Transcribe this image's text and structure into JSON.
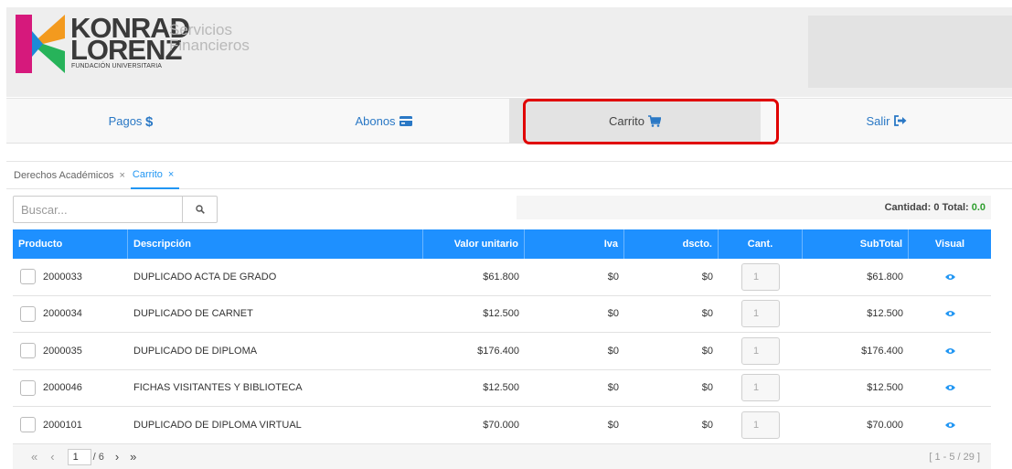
{
  "brand": {
    "line1": "KONRAD",
    "line2": "LORENZ",
    "tagline": "FUNDACIÓN UNIVERSITARIA",
    "service1": "Servicios",
    "service2": "Financieros",
    "colors": {
      "magenta": "#d6197c",
      "orange": "#f39a1e",
      "green": "#27b35a",
      "blue": "#1d8ad8",
      "gray": "#b9b9b9"
    }
  },
  "nav": {
    "items": [
      {
        "label": "Pagos",
        "icon": "dollar-icon"
      },
      {
        "label": "Abonos",
        "icon": "credit-card-icon"
      },
      {
        "label": "Carrito",
        "icon": "cart-icon",
        "active": true
      },
      {
        "label": "Salir",
        "icon": "sign-out-icon"
      }
    ],
    "highlight_color": "#e00000"
  },
  "tabs": [
    {
      "label": "Derechos Académicos",
      "close": "×"
    },
    {
      "label": "Carrito",
      "close": "×",
      "active": true
    }
  ],
  "search": {
    "placeholder": "Buscar...",
    "icon": "search-icon"
  },
  "summary": {
    "quantity_label": "Cantidad:",
    "quantity_value": "0",
    "total_label": "Total:",
    "total_value": "0.0"
  },
  "table": {
    "header_color": "#1e90ff",
    "columns": [
      "Producto",
      "Descripción",
      "Valor unitario",
      "Iva",
      "dscto.",
      "Cant.",
      "SubTotal",
      "Visual"
    ],
    "rows": [
      {
        "producto": "2000033",
        "descripcion": "DUPLICADO ACTA DE GRADO",
        "valor": "$61.800",
        "iva": "$0",
        "dscto": "$0",
        "cant": "1",
        "subtotal": "$61.800"
      },
      {
        "producto": "2000034",
        "descripcion": "DUPLICADO DE CARNET",
        "valor": "$12.500",
        "iva": "$0",
        "dscto": "$0",
        "cant": "1",
        "subtotal": "$12.500"
      },
      {
        "producto": "2000035",
        "descripcion": "DUPLICADO DE DIPLOMA",
        "valor": "$176.400",
        "iva": "$0",
        "dscto": "$0",
        "cant": "1",
        "subtotal": "$176.400"
      },
      {
        "producto": "2000046",
        "descripcion": "FICHAS VISITANTES Y BIBLIOTECA",
        "valor": "$12.500",
        "iva": "$0",
        "dscto": "$0",
        "cant": "1",
        "subtotal": "$12.500"
      },
      {
        "producto": "2000101",
        "descripcion": "DUPLICADO DE DIPLOMA VIRTUAL",
        "valor": "$70.000",
        "iva": "$0",
        "dscto": "$0",
        "cant": "1",
        "subtotal": "$70.000"
      }
    ]
  },
  "pager": {
    "first": "«",
    "prev": "‹",
    "page": "1",
    "of_total": "/ 6",
    "next": "›",
    "last": "»",
    "range": "[ 1 - 5 / 29 ]"
  }
}
